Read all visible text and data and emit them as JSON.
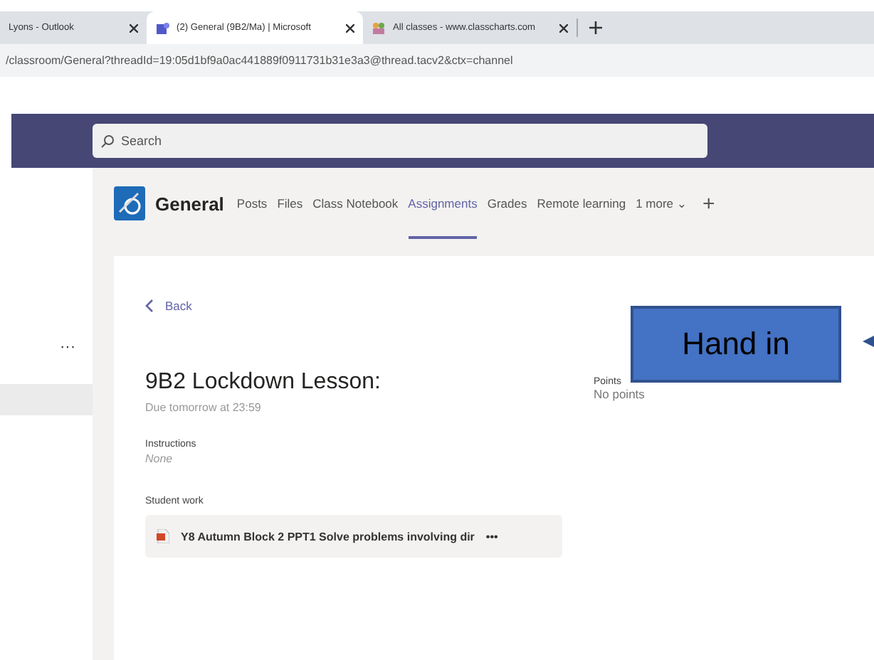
{
  "browser_tabs": [
    {
      "title": "Lyons - Outlook",
      "selected": false
    },
    {
      "title": "(2) General (9B2/Ma) | Microsoft",
      "selected": true
    },
    {
      "title": "All classes - www.classcharts.com",
      "selected": false
    }
  ],
  "address": "/classroom/General?threadId=19:05d1bf9a0ac441889f0911731b31e3a3@thread.tacv2&ctx=channel",
  "search": {
    "placeholder": "Search"
  },
  "sidebar": {
    "more": "···"
  },
  "channel": {
    "name": "General",
    "tabs": [
      {
        "label": "Posts",
        "selected": false
      },
      {
        "label": "Files",
        "selected": false
      },
      {
        "label": "Class Notebook",
        "selected": false
      },
      {
        "label": "Assignments",
        "selected": true
      },
      {
        "label": "Grades",
        "selected": false
      },
      {
        "label": "Remote learning",
        "selected": false
      }
    ],
    "more": "1 more",
    "more_caret": "⌄",
    "add": "+"
  },
  "assignment": {
    "back": "Back",
    "title": "9B2 Lockdown Lesson:",
    "due": "Due tomorrow at 23:59",
    "points_label": "Points",
    "points_value": "No points",
    "instructions_label": "Instructions",
    "instructions_value": "None",
    "student_work_label": "Student work",
    "file": {
      "name": "Y8 Autumn Block 2 PPT1 Solve problems involving dir",
      "more": "•••"
    }
  },
  "callout": "Hand in"
}
